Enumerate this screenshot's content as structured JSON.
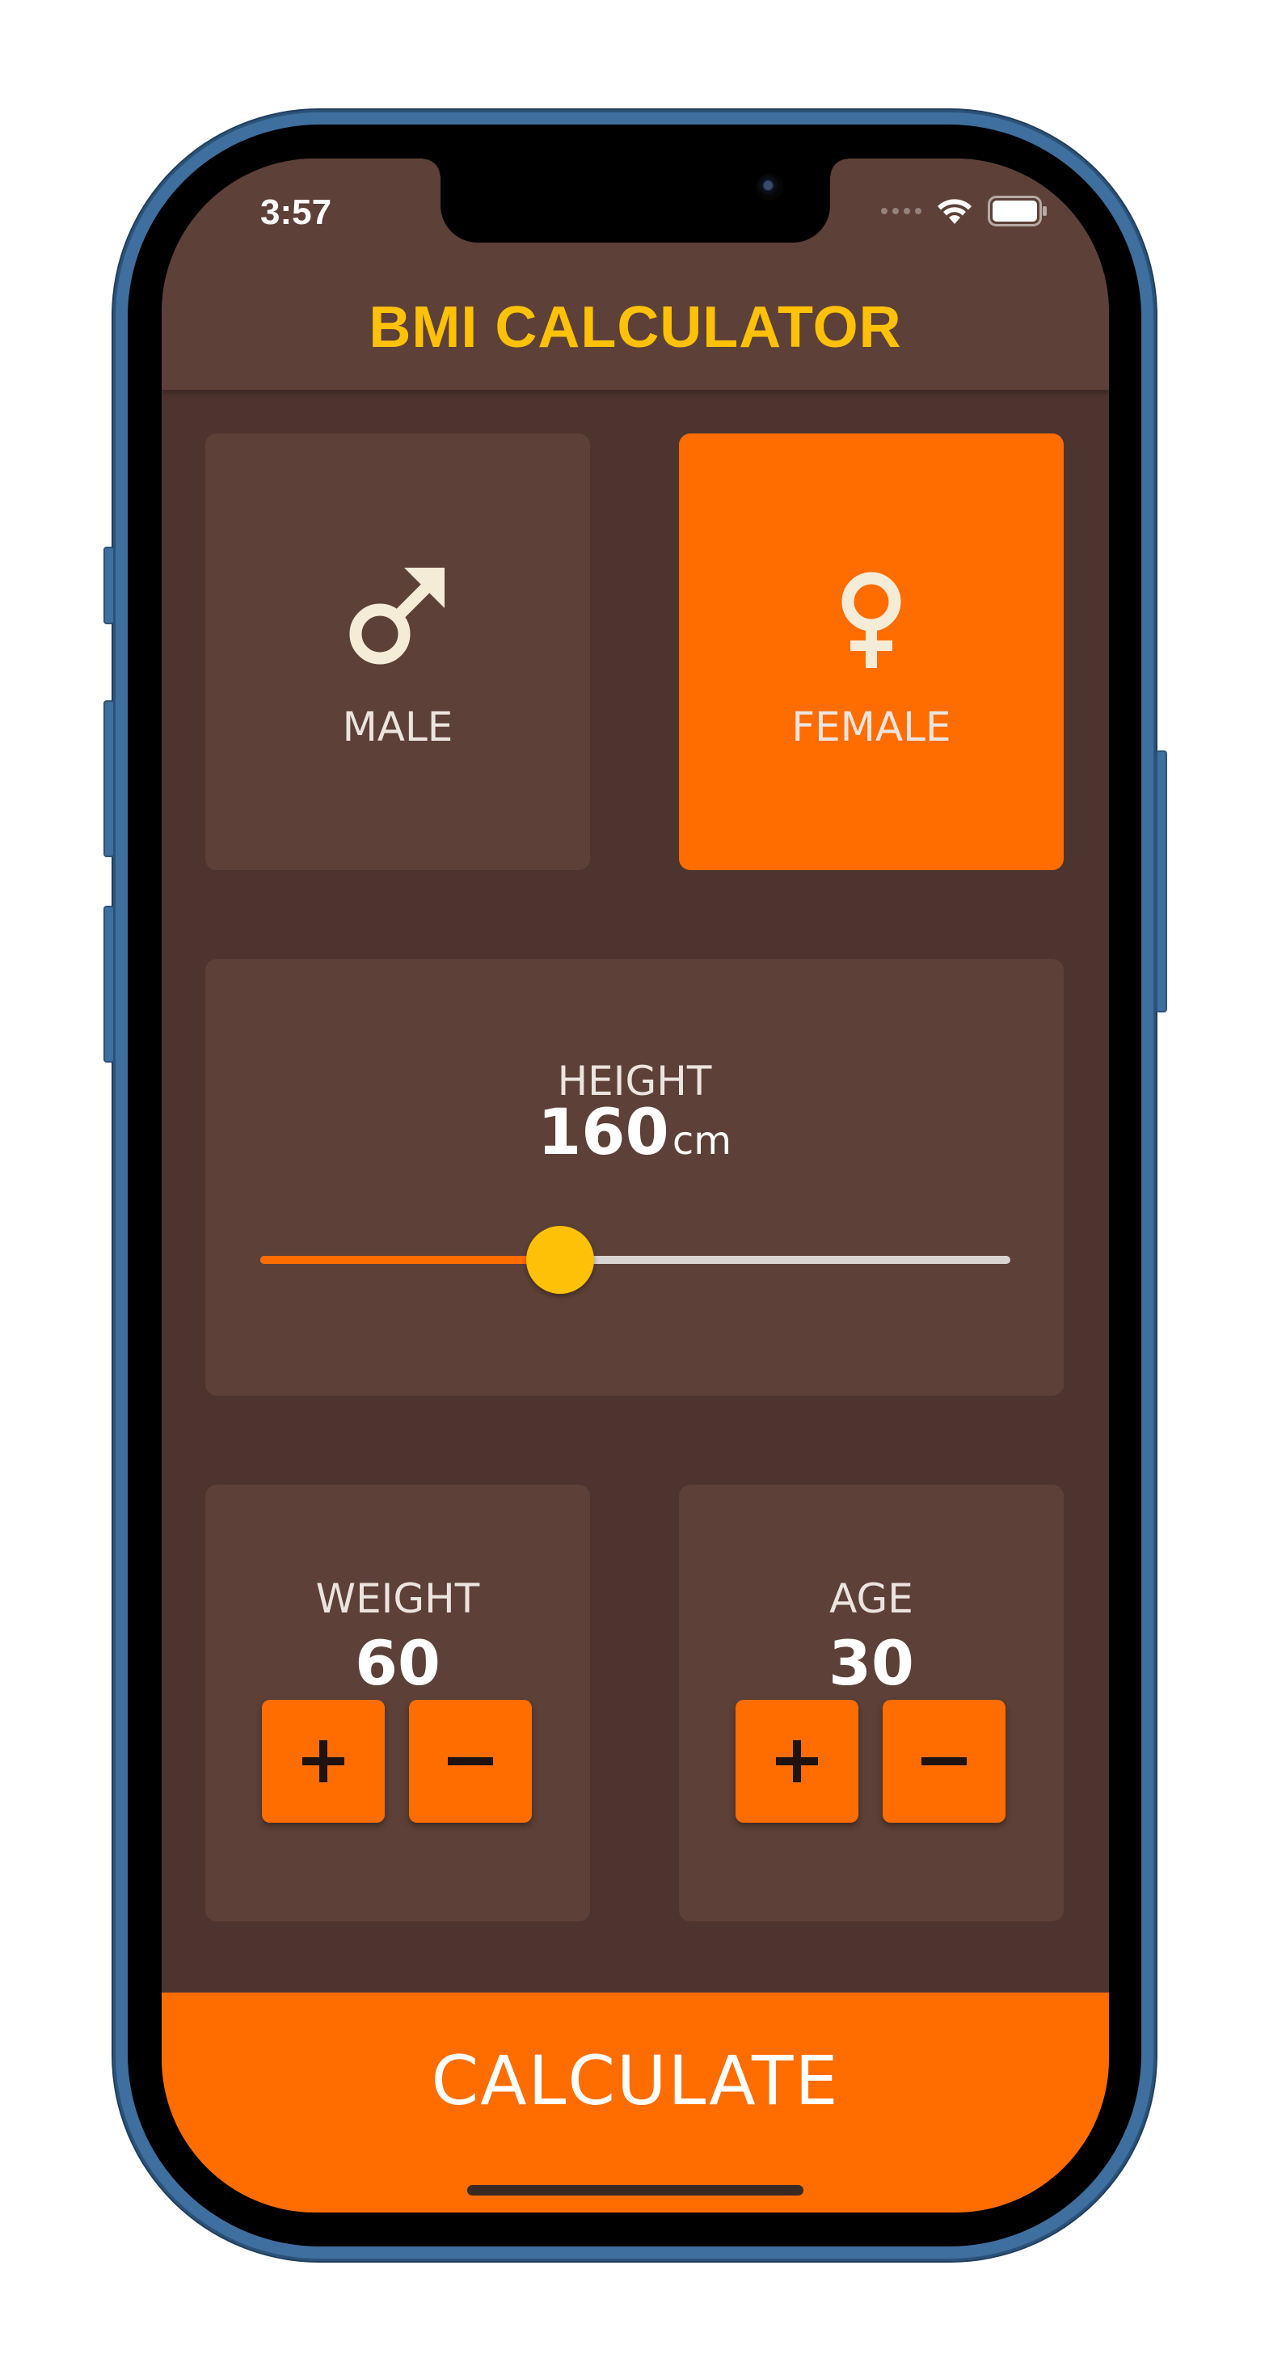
{
  "status_bar": {
    "time": "3:57"
  },
  "app": {
    "title": "BMI CALCULATOR"
  },
  "gender": {
    "male_label": "MALE",
    "female_label": "FEMALE",
    "selected": "FEMALE",
    "male_icon": "male-symbol-icon",
    "female_icon": "female-symbol-icon"
  },
  "height": {
    "label": "HEIGHT",
    "value": "160",
    "unit": "cm",
    "slider_fraction": 0.4
  },
  "weight": {
    "label": "WEIGHT",
    "value": "60"
  },
  "age": {
    "label": "AGE",
    "value": "30"
  },
  "calculate": {
    "label": "CALCULATE"
  },
  "colors": {
    "background": "#4e342e",
    "card": "#5d4037",
    "accent": "#ff6d00",
    "title": "#ffc107",
    "thumb": "#ffc107"
  }
}
